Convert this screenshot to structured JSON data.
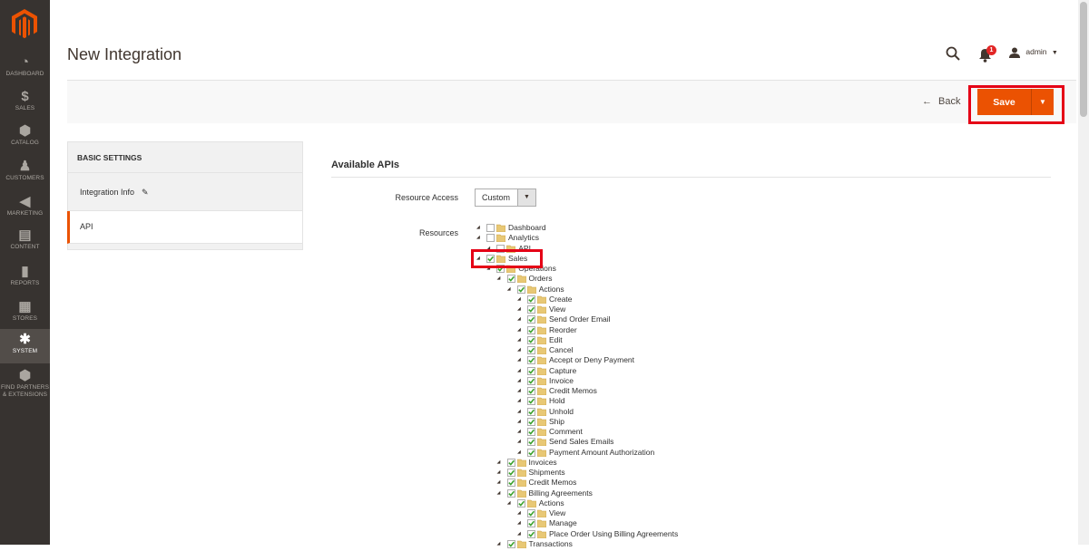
{
  "nav": {
    "items": [
      {
        "label": "DASHBOARD",
        "icon": "dashboard-icon"
      },
      {
        "label": "SALES",
        "icon": "dollar-icon"
      },
      {
        "label": "CATALOG",
        "icon": "box-icon"
      },
      {
        "label": "CUSTOMERS",
        "icon": "person-icon"
      },
      {
        "label": "MARKETING",
        "icon": "megaphone-icon"
      },
      {
        "label": "CONTENT",
        "icon": "layout-icon"
      },
      {
        "label": "REPORTS",
        "icon": "bar-chart-icon"
      },
      {
        "label": "STORES",
        "icon": "store-icon"
      },
      {
        "label": "SYSTEM",
        "icon": "gear-icon"
      },
      {
        "label": "FIND PARTNERS & EXTENSIONS",
        "icon": "cube-icon"
      }
    ],
    "active": "SYSTEM"
  },
  "header": {
    "title": "New Integration",
    "notifications_count": "1",
    "user": "admin"
  },
  "actions": {
    "back_label": "Back",
    "save_label": "Save"
  },
  "tabs": {
    "heading": "BASIC SETTINGS",
    "items": [
      {
        "label": "Integration Info",
        "active": false
      },
      {
        "label": "API",
        "active": true
      }
    ]
  },
  "apis": {
    "section_title": "Available APIs",
    "resource_access_label": "Resource Access",
    "resource_access_value": "Custom",
    "resources_label": "Resources"
  },
  "tree": [
    {
      "label": "Dashboard",
      "level": 0,
      "checked": false
    },
    {
      "label": "Analytics",
      "level": 0,
      "checked": false
    },
    {
      "label": "API",
      "level": 1,
      "checked": false
    },
    {
      "label": "Sales",
      "level": 0,
      "checked": true
    },
    {
      "label": "Operations",
      "level": 1,
      "checked": true
    },
    {
      "label": "Orders",
      "level": 2,
      "checked": true
    },
    {
      "label": "Actions",
      "level": 3,
      "checked": true
    },
    {
      "label": "Create",
      "level": 4,
      "checked": true
    },
    {
      "label": "View",
      "level": 4,
      "checked": true
    },
    {
      "label": "Send Order Email",
      "level": 4,
      "checked": true
    },
    {
      "label": "Reorder",
      "level": 4,
      "checked": true
    },
    {
      "label": "Edit",
      "level": 4,
      "checked": true
    },
    {
      "label": "Cancel",
      "level": 4,
      "checked": true
    },
    {
      "label": "Accept or Deny Payment",
      "level": 4,
      "checked": true
    },
    {
      "label": "Capture",
      "level": 4,
      "checked": true
    },
    {
      "label": "Invoice",
      "level": 4,
      "checked": true
    },
    {
      "label": "Credit Memos",
      "level": 4,
      "checked": true
    },
    {
      "label": "Hold",
      "level": 4,
      "checked": true
    },
    {
      "label": "Unhold",
      "level": 4,
      "checked": true
    },
    {
      "label": "Ship",
      "level": 4,
      "checked": true
    },
    {
      "label": "Comment",
      "level": 4,
      "checked": true
    },
    {
      "label": "Send Sales Emails",
      "level": 4,
      "checked": true
    },
    {
      "label": "Payment Amount Authorization",
      "level": 4,
      "checked": true
    },
    {
      "label": "Invoices",
      "level": 2,
      "checked": true
    },
    {
      "label": "Shipments",
      "level": 2,
      "checked": true
    },
    {
      "label": "Credit Memos",
      "level": 2,
      "checked": true
    },
    {
      "label": "Billing Agreements",
      "level": 2,
      "checked": true
    },
    {
      "label": "Actions",
      "level": 3,
      "checked": true
    },
    {
      "label": "View",
      "level": 4,
      "checked": true
    },
    {
      "label": "Manage",
      "level": 4,
      "checked": true
    },
    {
      "label": "Place Order Using Billing Agreements",
      "level": 4,
      "checked": true
    },
    {
      "label": "Transactions",
      "level": 2,
      "checked": true
    }
  ],
  "colors": {
    "accent": "#eb5202",
    "nav_bg": "#373330",
    "highlight": "#e50016"
  }
}
